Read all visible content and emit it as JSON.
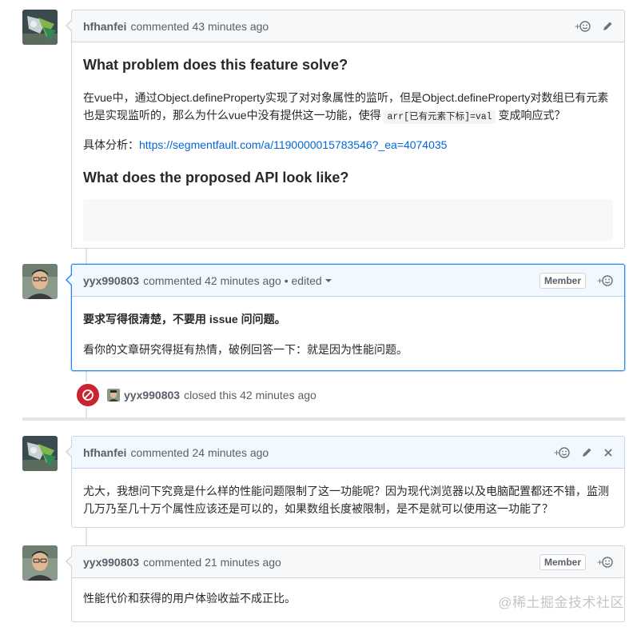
{
  "comments": [
    {
      "author": "hfhanfei",
      "meta": "commented 43 minutes ago",
      "heading1": "What problem does this feature solve?",
      "para1_a": "在vue中，通过Object.defineProperty实现了对对象属性的监听，但是Object.defineProperty对数组已有元素也是实现监听的，那么为什么vue中没有提供这一功能，使得 ",
      "para1_code": "arr[已有元素下标]=val",
      "para1_b": " 变成响应式？",
      "analysis_label": "具体分析：",
      "analysis_link": "https://segmentfault.com/a/1190000015783546?_ea=4074035",
      "heading2": "What does the proposed API look like?"
    },
    {
      "author": "yyx990803",
      "meta": "commented 42 minutes ago • edited",
      "badge": "Member",
      "bold_line": "要求写得很清楚，不要用 issue 问问题。",
      "line2": "看你的文章研究得挺有热情，破例回答一下：就是因为性能问题。"
    },
    {
      "author": "hfhanfei",
      "meta": "commented 24 minutes ago",
      "body": "尤大，我想问下究竟是什么样的性能问题限制了这一功能呢？因为现代浏览器以及电脑配置都还不错，监测几万乃至几十万个属性应该还是可以的，如果数组长度被限制，是不是就可以使用这一功能了？"
    },
    {
      "author": "yyx990803",
      "meta": "commented 21 minutes ago",
      "badge": "Member",
      "body": "性能代价和获得的用户体验收益不成正比。"
    }
  ],
  "event": {
    "actor": "yyx990803",
    "text": "closed this 42 minutes ago"
  },
  "watermark": "@稀土掘金技术社区",
  "colors": {
    "link": "#0366d6",
    "closed": "#cb2431",
    "selected_border": "#2188ff",
    "header_bg": "#f1f8ff"
  },
  "icons": [
    "smiley-add-icon",
    "pencil-icon",
    "close-icon",
    "blocked-icon",
    "dropdown-caret-icon"
  ]
}
